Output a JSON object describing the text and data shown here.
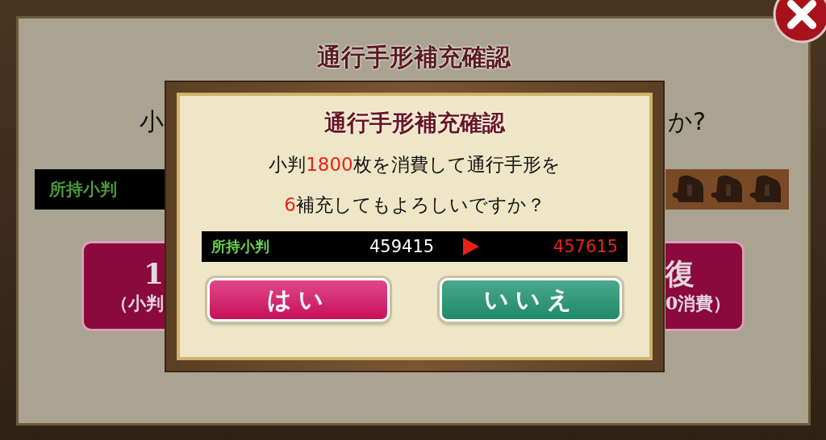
{
  "background_dialog": {
    "title": "通行手形補充確認",
    "question_start": "小",
    "question_end": "か?",
    "balance_label": "所持小判",
    "left_button": {
      "line_1": "1",
      "line_2": "（小判"
    },
    "right_button": {
      "line_1": "復",
      "line_2": "0消費）"
    }
  },
  "confirm_dialog": {
    "title": "通行手形補充確認",
    "message_lines": [
      "小判**1800**枚を消費して通行手形を",
      "**6**補充してもよろしいですか？"
    ],
    "balance": {
      "label": "所持小判",
      "current": "459415",
      "after": "457615"
    },
    "buttons": [
      {
        "label": "はい",
        "kind": "yes"
      },
      {
        "label": "いいえ",
        "kind": "no"
      }
    ]
  }
}
